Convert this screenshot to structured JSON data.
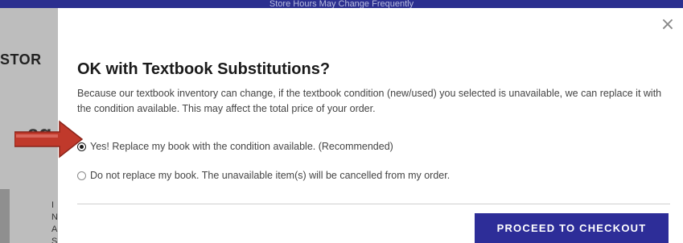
{
  "background": {
    "banner_text": "Store Hours May Change Frequently",
    "store_fragment": "STOR",
    "heading_fragment": "ag",
    "side_letters": "I\nN\nA\nS"
  },
  "modal": {
    "close_label": "×",
    "title": "OK with Textbook Substitutions?",
    "description": "Because our textbook inventory can change, if the textbook condition (new/used) you selected is unavailable, we can replace it with the condition available. This may affect the total price of your order.",
    "options": [
      {
        "label": "Yes! Replace my book with the condition available. (Recommended)",
        "selected": true
      },
      {
        "label": "Do not replace my book. The unavailable item(s) will be cancelled from my order.",
        "selected": false
      }
    ],
    "proceed_label": "PROCEED TO CHECKOUT"
  },
  "annotation": {
    "arrow_color": "#c0392b"
  },
  "colors": {
    "primary": "#2d2d98",
    "banner": "#2b2f8f"
  }
}
